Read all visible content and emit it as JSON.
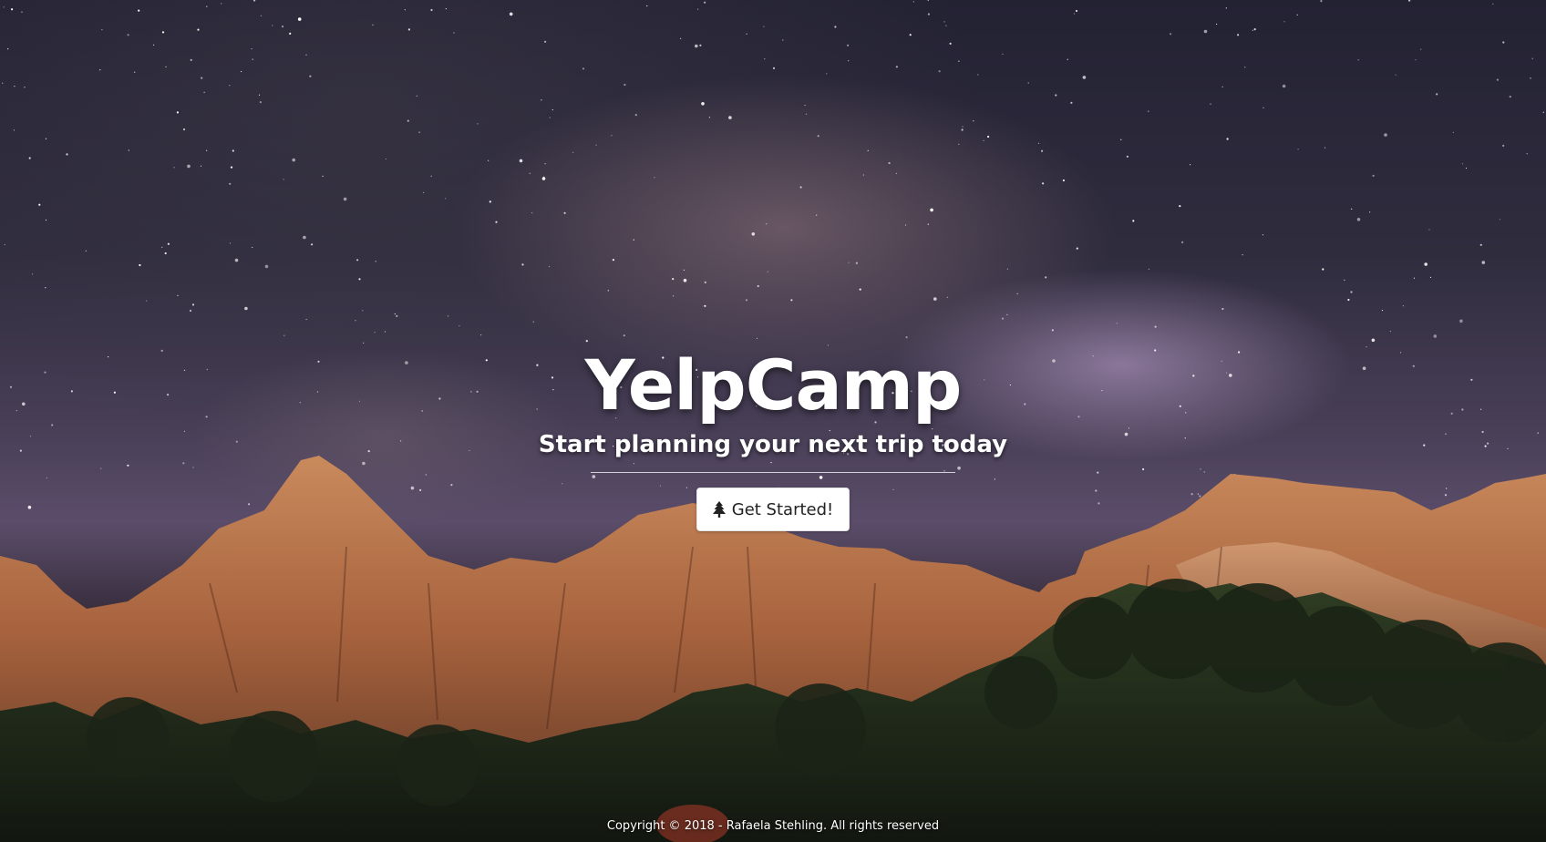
{
  "hero": {
    "title": "YelpCamp",
    "subtitle": "Start planning your next trip today",
    "button_label": "Get Started!",
    "button_icon": "tree-icon"
  },
  "footer": {
    "copyright": "Copyright © 2018 - Rafaela Stehling. All rights reserved"
  },
  "background": {
    "scene": "starry night sky over red rock cliffs and trees"
  }
}
